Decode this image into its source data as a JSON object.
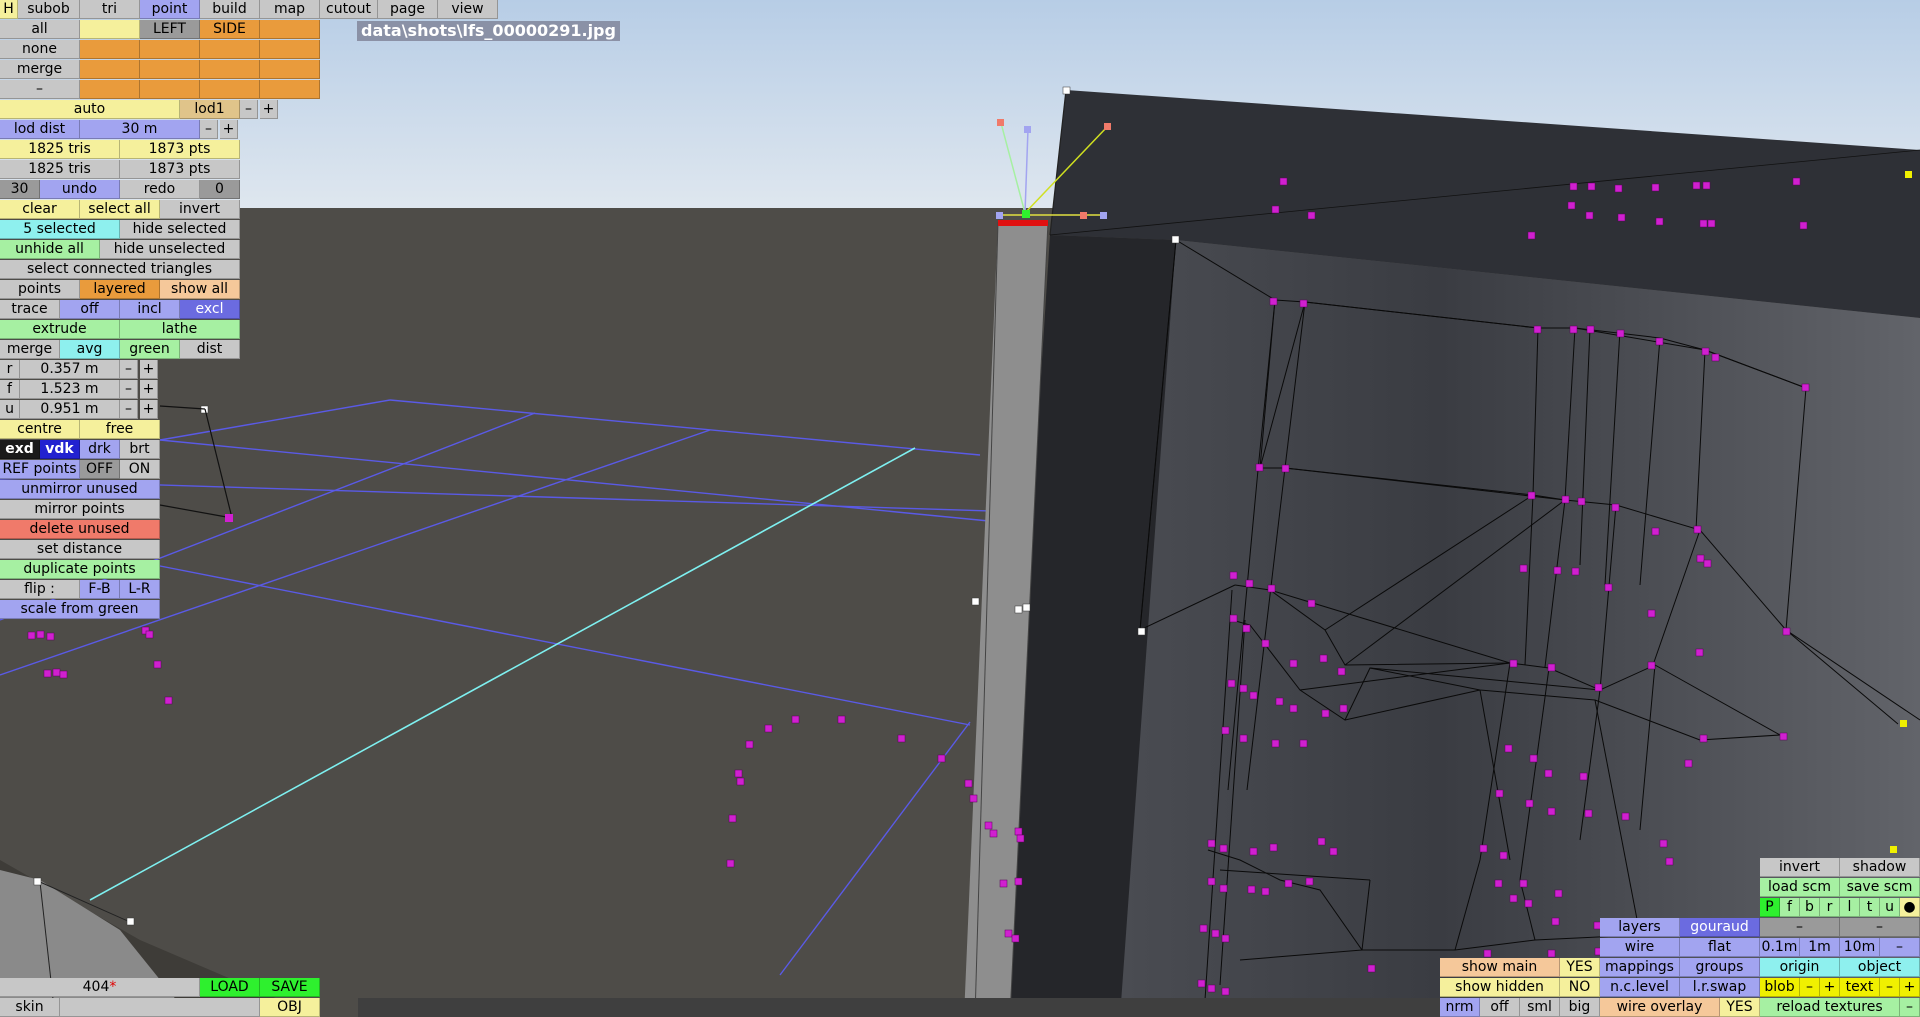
{
  "file_title": "data\\shots\\lfs_00000291.jpg",
  "menu": {
    "h": "H",
    "subob": "subob",
    "tri": "tri",
    "point": "point",
    "build": "build",
    "map": "map",
    "cutout": "cutout",
    "page": "page",
    "view": "view"
  },
  "sel": {
    "all": "all",
    "none": "none",
    "merge": "merge",
    "dash": "–",
    "left": "LEFT",
    "side": "SIDE"
  },
  "lod": {
    "auto": "auto",
    "lod1": "lod1",
    "minus": "–",
    "plus": "+",
    "dist_label": "lod dist",
    "dist_val": "30 m"
  },
  "stats": {
    "tris1": "1825 tris",
    "pts1": "1873 pts",
    "tris2": "1825 tris",
    "pts2": "1873 pts"
  },
  "undo": {
    "count": "30",
    "undo": "undo",
    "redo": "redo",
    "redo_count": "0"
  },
  "edit": {
    "clear": "clear",
    "select_all": "select all",
    "invert": "invert",
    "selected": "5 selected",
    "hide_selected": "hide selected",
    "unhide_all": "unhide all",
    "hide_unselected": "hide unselected",
    "select_connected": "select connected triangles",
    "points": "points",
    "layered": "layered",
    "show_all": "show all",
    "trace": "trace",
    "off": "off",
    "incl": "incl",
    "excl": "excl",
    "extrude": "extrude",
    "lathe": "lathe",
    "merge": "merge",
    "avg": "avg",
    "green": "green",
    "dist": "dist"
  },
  "coords": [
    {
      "axis": "r",
      "value": "0.357 m"
    },
    {
      "axis": "f",
      "value": "1.523 m"
    },
    {
      "axis": "u",
      "value": "0.951 m"
    }
  ],
  "tools": {
    "centre": "centre",
    "free": "free",
    "exd": "exd",
    "vdk": "vdk",
    "drk": "drk",
    "brt": "brt",
    "ref_points": "REF points",
    "ref_off": "OFF",
    "ref_on": "ON",
    "unmirror": "unmirror unused",
    "mirror": "mirror points",
    "delete_unused": "delete unused",
    "set_distance": "set distance",
    "duplicate": "duplicate points",
    "flip": "flip :",
    "fb": "F-B",
    "lr": "L-R",
    "scale_green": "scale from green"
  },
  "bottom_left": {
    "count": "404",
    "modified_mark": "*",
    "load": "LOAD",
    "save": "SAVE",
    "skin": "skin",
    "obj": "OBJ"
  },
  "view_panel": {
    "show_main": "show main",
    "show_main_val": "YES",
    "show_hidden": "show hidden",
    "show_hidden_val": "NO",
    "nrm": "nrm",
    "off": "off",
    "sml": "sml",
    "big": "big",
    "layers": "layers",
    "gouraud": "gouraud",
    "wire": "wire",
    "flat": "flat",
    "mappings": "mappings",
    "groups": "groups",
    "nc_level": "n.c.level",
    "lr_swap": "l.r.swap",
    "wire_overlay": "wire overlay",
    "wire_overlay_val": "YES"
  },
  "right_panel": {
    "invert": "invert",
    "shadow": "shadow",
    "load_scm": "load scm",
    "save_scm": "save scm",
    "letters": [
      "P",
      "f",
      "b",
      "r",
      "l",
      "t",
      "u",
      "●"
    ],
    "dash1": "–",
    "dash2": "–",
    "s01": "0.1m",
    "s1": "1m",
    "s10": "10m",
    "sdash": "–",
    "origin": "origin",
    "object": "object",
    "blob": "blob",
    "minus": "–",
    "plus": "+",
    "text": "text",
    "tminus": "–",
    "tplus": "+",
    "reload": "reload textures",
    "rdash": "–"
  },
  "colors": {
    "sky_top": "#b7cde6",
    "sky_bottom": "#dfe7ef",
    "ground": "#4e4c48",
    "wall": "#2e3036",
    "point_magenta": "#d020d0",
    "grid_blue": "#5a5ae6",
    "grid_cyan": "#7ef0f0"
  }
}
